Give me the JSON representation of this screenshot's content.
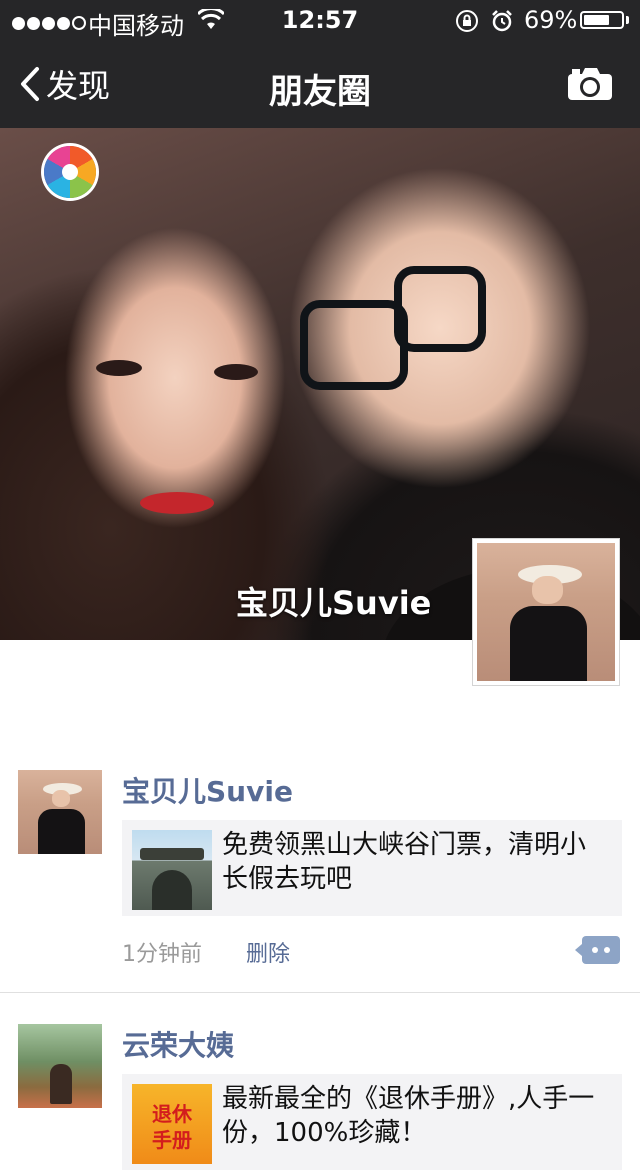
{
  "status_bar": {
    "carrier": "中国移动",
    "time": "12:57",
    "battery_percent": "69%",
    "battery_level": 0.69
  },
  "nav": {
    "back_label": "发现",
    "title": "朋友圈"
  },
  "cover": {
    "profile_name": "宝贝儿Suvie"
  },
  "posts": [
    {
      "author": "宝贝儿Suvie",
      "share_title": "免费领黑山大峡谷门票，清明小长假去玩吧",
      "time": "1分钟前",
      "delete_label": "删除"
    },
    {
      "author": "云荣大姨",
      "share_title": "最新最全的《退休手册》,人手一份，100%珍藏！",
      "thumb_text": [
        "退休",
        "手册"
      ]
    }
  ],
  "colors": {
    "nav_bg": "#262628",
    "link": "#576b95",
    "card_bg": "#f3f3f5"
  }
}
